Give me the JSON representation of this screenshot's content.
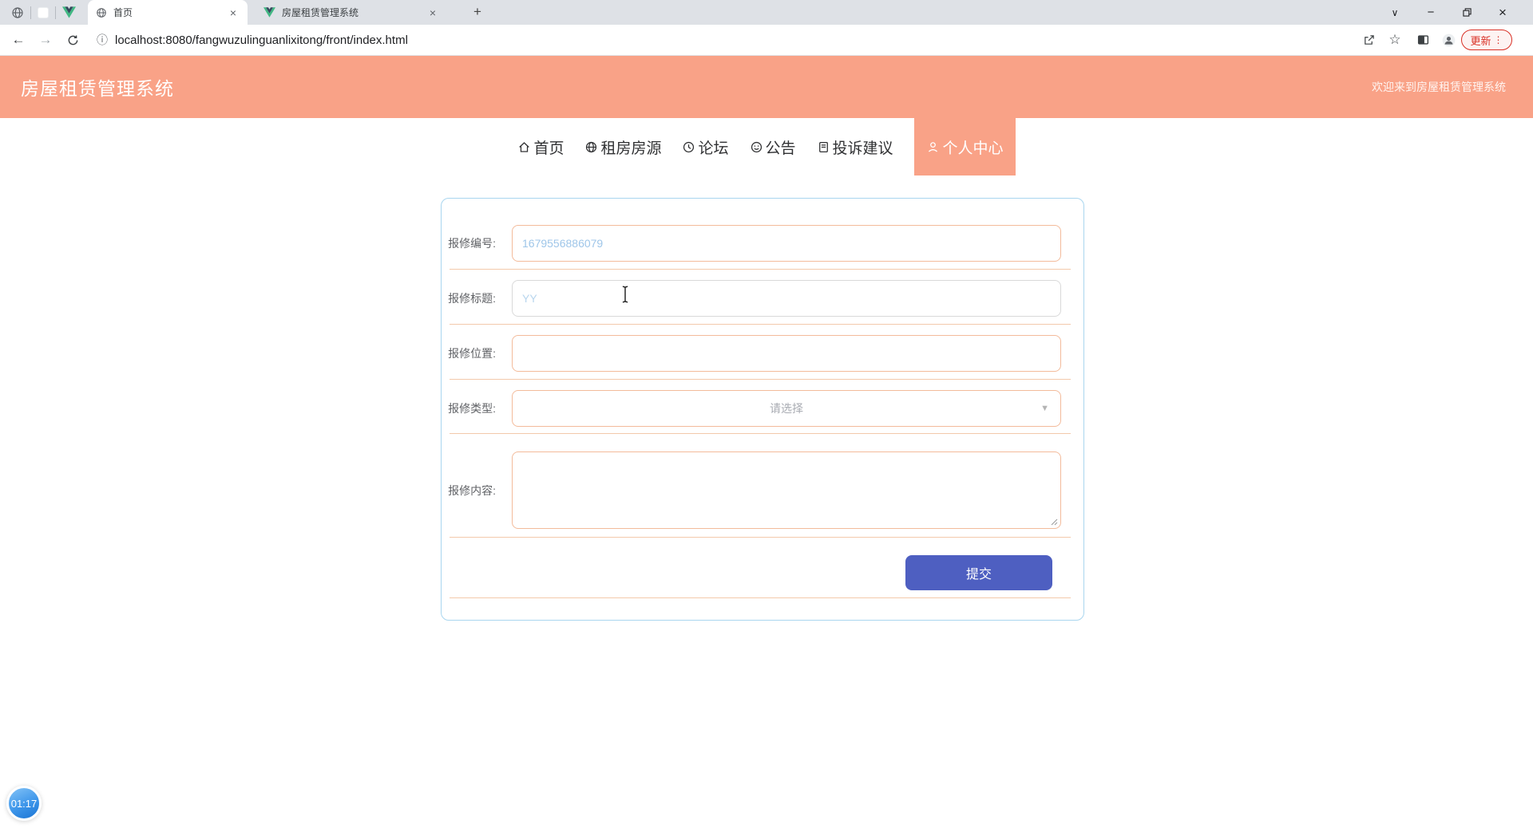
{
  "colors": {
    "accent_salmon": "#f9a287",
    "button_indigo": "#4e5fc1",
    "card_border": "#a9d6ef",
    "input_border": "#f3bb9b",
    "row_divider": "#f3c9ab",
    "placeholder_blue": "#9fc6e9",
    "update_red": "#d93025"
  },
  "icons": {
    "back": "←",
    "forward": "→",
    "info": "ⓘ",
    "star": "☆",
    "dots": "⋮",
    "chevron": "∨",
    "minus": "−",
    "close": "×",
    "plus": "+",
    "caret_down": "▼"
  },
  "browser": {
    "tabs": [
      {
        "title": "首页"
      },
      {
        "title": "房屋租赁管理系统"
      }
    ],
    "url": "localhost:8080/fangwuzulinguanlixitong/front/index.html",
    "update_button": "更新"
  },
  "header": {
    "title": "房屋租赁管理系统",
    "welcome": "欢迎来到房屋租赁管理系统"
  },
  "nav": {
    "items": [
      {
        "label": "首页"
      },
      {
        "label": "租房房源"
      },
      {
        "label": "论坛"
      },
      {
        "label": "公告"
      },
      {
        "label": "投诉建议"
      }
    ],
    "active": {
      "label": "个人中心"
    }
  },
  "form": {
    "fields": [
      {
        "label": "报修编号:",
        "value": "1679556886079"
      },
      {
        "label": "报修标题:",
        "value": "YY"
      },
      {
        "label": "报修位置:",
        "value": ""
      },
      {
        "label": "报修类型:",
        "placeholder": "请选择"
      },
      {
        "label": "报修内容:",
        "value": ""
      }
    ],
    "submit_label": "提交"
  },
  "recorder": {
    "time": "01:17"
  }
}
